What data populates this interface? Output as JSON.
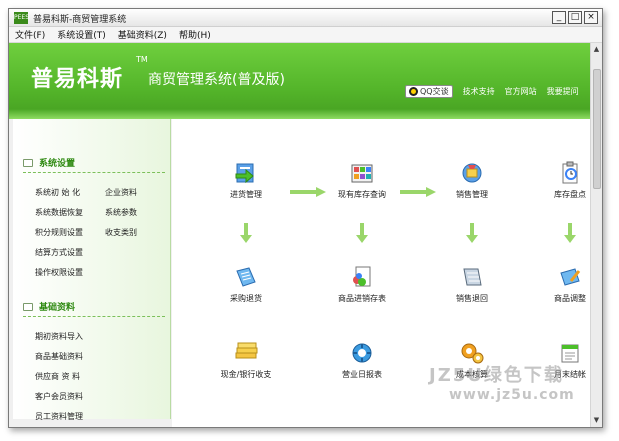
{
  "window": {
    "title": "普易科斯-商贸管理系统",
    "icon_text": "PEES",
    "controls": [
      "_",
      "□",
      "×"
    ]
  },
  "menu": [
    "文件(F)",
    "系统设置(T)",
    "基础资料(Z)",
    "帮助(H)"
  ],
  "header": {
    "brand": "普易科斯",
    "tm": "TM",
    "subtitle": "商贸管理系统(普及版)",
    "qq_label": "QQ交谈",
    "links": [
      "技术支持",
      "官方网站",
      "我要提问"
    ]
  },
  "sidebar": {
    "system_settings": {
      "title": "系统设置",
      "items": [
        "系统初 始 化",
        "企业资料",
        "系统数据恢复",
        "系统参数",
        "积分规则设置",
        "收支类别",
        "结算方式设置",
        "操作权限设置"
      ]
    },
    "basic_data": {
      "title": "基础资料",
      "items": [
        "期初资料导入",
        "商品基础资料",
        "供应商 资 料",
        "客户会员资料",
        "员工资料管理"
      ]
    }
  },
  "workflow": {
    "row1": [
      "进货管理",
      "现有库存查询",
      "销售管理",
      "库存盘点"
    ],
    "row2": [
      "采购退货",
      "商品进销存表",
      "销售退回",
      "商品调整"
    ],
    "row3": [
      "现金/银行收支",
      "营业日报表",
      "成本核算",
      "月末结帐"
    ]
  },
  "watermark": {
    "line1": "JZ5U绿色下载",
    "line2": "www.jz5u.com"
  },
  "colors": {
    "banner_green": "#54b52a",
    "accent_green": "#2f8a12",
    "arrow_green": "#9ad66a"
  },
  "icons": {
    "row1": [
      "purchase-icon",
      "inventory-query-icon",
      "sales-icon",
      "stocktake-icon"
    ],
    "row2": [
      "purchase-return-icon",
      "stock-report-icon",
      "sales-return-icon",
      "goods-adjust-icon"
    ],
    "row3": [
      "cash-bank-icon",
      "daily-report-icon",
      "cost-accounting-icon",
      "month-end-icon"
    ]
  }
}
